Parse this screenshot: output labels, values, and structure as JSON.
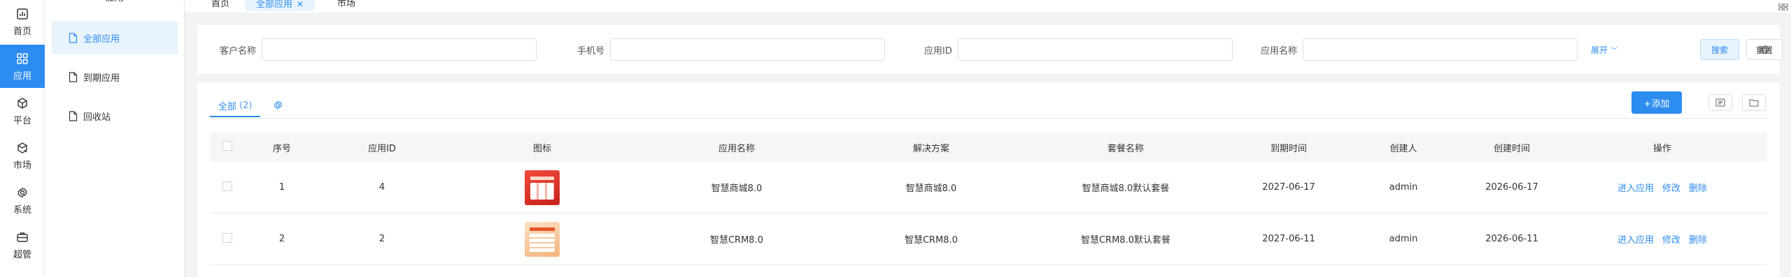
{
  "nav": {
    "items": [
      {
        "label": "首页",
        "icon": "dashboard-icon",
        "active": false
      },
      {
        "label": "应用",
        "icon": "apps-grid-icon",
        "active": true
      },
      {
        "label": "平台",
        "icon": "cube-icon",
        "active": false
      },
      {
        "label": "市场",
        "icon": "market-box-icon",
        "active": false
      },
      {
        "label": "系统",
        "icon": "gear-icon",
        "active": false
      },
      {
        "label": "超管",
        "icon": "briefcase-icon",
        "active": false
      }
    ]
  },
  "submenu": {
    "title": "应用",
    "items": [
      {
        "label": "全部应用",
        "active": true
      },
      {
        "label": "到期应用",
        "active": false
      },
      {
        "label": "回收站",
        "active": false
      }
    ]
  },
  "tabs": [
    {
      "label": "首页",
      "active": false,
      "closable": false
    },
    {
      "label": "全部应用",
      "active": true,
      "closable": true
    },
    {
      "label": "市场",
      "active": false,
      "closable": false
    }
  ],
  "search": {
    "customer_label": "客户名称",
    "customer_value": "",
    "phone_label": "手机号",
    "phone_value": "",
    "appid_label": "应用ID",
    "appid_value": "",
    "appname_label": "应用名称",
    "appname_value": "",
    "expand_label": "展开",
    "search_label": "搜索",
    "reset_label": "重置"
  },
  "list": {
    "tab_label": "全部",
    "tab_count": "(2)",
    "add_label": "+添加",
    "columns": [
      "序号",
      "应用ID",
      "图标",
      "应用名称",
      "解决方案",
      "套餐名称",
      "到期时间",
      "创建人",
      "创建时间",
      "操作"
    ],
    "rows": [
      {
        "index": "1",
        "app_id": "4",
        "icon": "red",
        "name": "智慧商城8.0",
        "solution": "智慧商城8.0",
        "package": "智慧商城8.0默认套餐",
        "expire": "2027-06-17",
        "creator": "admin",
        "created": "2026-06-17"
      },
      {
        "index": "2",
        "app_id": "2",
        "icon": "orange",
        "name": "智慧CRM8.0",
        "solution": "智慧CRM8.0",
        "package": "智慧CRM8.0默认套餐",
        "expire": "2027-06-11",
        "creator": "admin",
        "created": "2026-06-11"
      }
    ],
    "actions": {
      "enter": "进入应用",
      "edit": "修改",
      "delete": "删除"
    }
  },
  "colors": {
    "accent": "#2d8cf0",
    "active_bg": "#e8f3fe",
    "page_bg": "#f2f3f5"
  }
}
